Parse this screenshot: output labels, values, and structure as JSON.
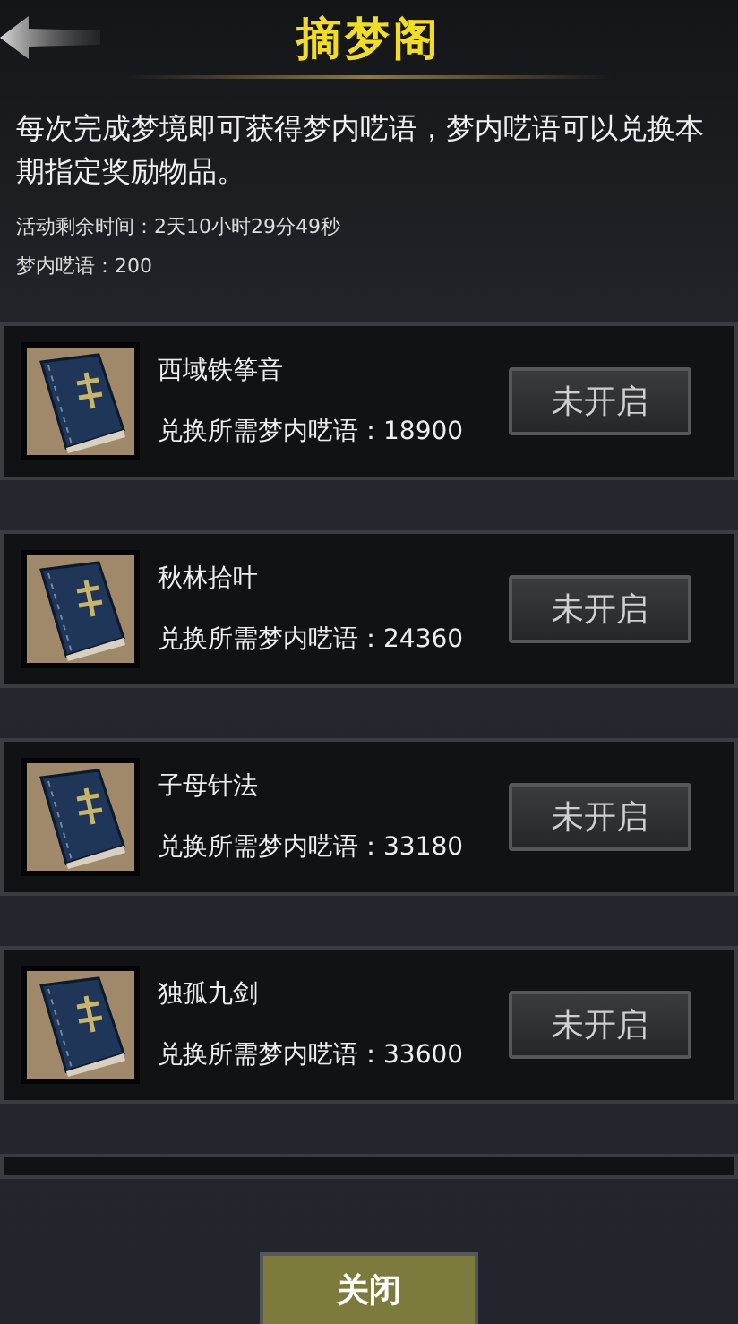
{
  "header": {
    "title": "摘梦阁"
  },
  "description": "每次完成梦境即可获得梦内呓语，梦内呓语可以兑换本期指定奖励物品。",
  "info": [
    {
      "text": "活动剩余时间：2天10小时29分49秒"
    },
    {
      "text": "梦内呓语：200"
    }
  ],
  "rewards": [
    {
      "name": "西域铁筝音",
      "cost": "兑换所需梦内呓语：18900",
      "button": "未开启",
      "disabled": true
    },
    {
      "name": "秋林拾叶",
      "cost": "兑换所需梦内呓语：24360",
      "button": "未开启",
      "disabled": true
    },
    {
      "name": "子母针法",
      "cost": "兑换所需梦内呓语：33180",
      "button": "未开启",
      "disabled": true
    },
    {
      "name": "独孤九剑",
      "cost": "兑换所需梦内呓语：33600",
      "button": "未开启",
      "disabled": true
    }
  ],
  "close_button": "关闭"
}
